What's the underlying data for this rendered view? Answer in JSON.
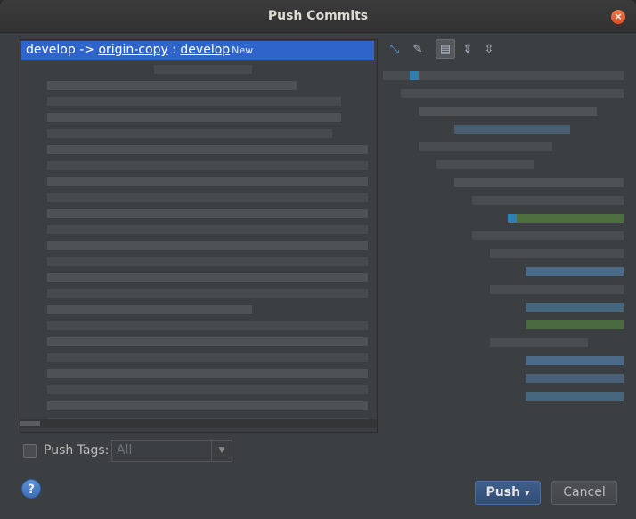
{
  "window": {
    "title": "Push Commits"
  },
  "branch_row": {
    "source": "develop",
    "arrow": " -> ",
    "remote": "origin-copy",
    "sep": " : ",
    "target": "develop",
    "badge": "New"
  },
  "toolbar": {
    "icons": [
      "expand-icon",
      "edit-icon",
      "folder-icon",
      "expand-all-icon",
      "collapse-all-icon"
    ]
  },
  "push_tags": {
    "label": "Push Tags:",
    "checked": false,
    "select_value": "All"
  },
  "buttons": {
    "help": "?",
    "push": "Push",
    "push_dropdown": "▾",
    "cancel": "Cancel"
  },
  "close_glyph": "×"
}
